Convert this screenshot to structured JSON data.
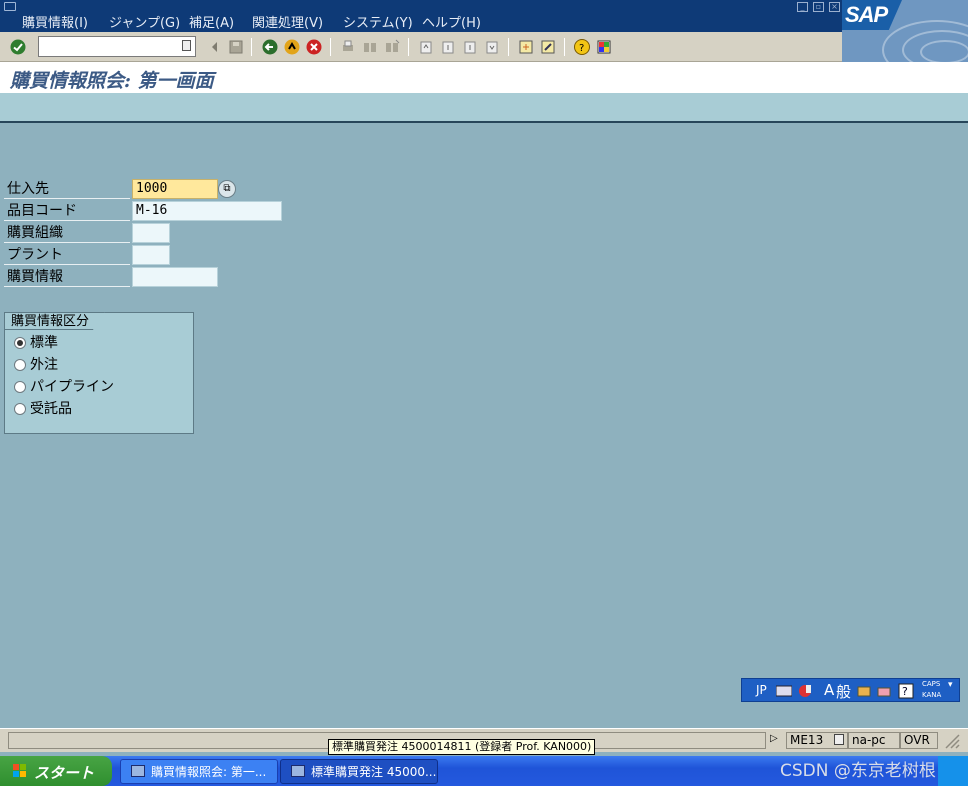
{
  "menu": {
    "items": [
      "購買情報(I)",
      "ジャンプ(G)",
      "補足(A)",
      "関連処理(V)",
      "システム(Y)",
      "ヘルプ(H)"
    ]
  },
  "brand": {
    "logo_text": "SAP",
    "accent": "#0e3a77"
  },
  "toolbar": {
    "command_value": "",
    "icons": [
      "enter-icon",
      "back-icon",
      "exit-icon",
      "cancel-icon",
      "print-icon",
      "find-icon",
      "find-next-icon",
      "first-page-icon",
      "previous-page-icon",
      "next-page-icon",
      "last-page-icon",
      "new-session-icon",
      "shortcut-icon",
      "help-icon",
      "layout-icon"
    ]
  },
  "title": "購買情報照会: 第一画面",
  "form": {
    "vendor": {
      "label": "仕入先",
      "value": "1000"
    },
    "material": {
      "label": "品目コード",
      "value": "M-16"
    },
    "purch_org": {
      "label": "購買組織",
      "value": ""
    },
    "plant": {
      "label": "プラント",
      "value": ""
    },
    "info_record": {
      "label": "購買情報",
      "value": ""
    }
  },
  "group": {
    "title": "購買情報区分",
    "options": [
      {
        "label": "標準",
        "selected": true
      },
      {
        "label": "外注",
        "selected": false
      },
      {
        "label": "パイプライン",
        "selected": false
      },
      {
        "label": "受託品",
        "selected": false
      }
    ]
  },
  "ime": {
    "lang": "JP",
    "mode": "A",
    "mode2": "般",
    "caps": "CAPS",
    "kana": "KANA"
  },
  "status": {
    "message": "",
    "tooltip": "標準購買発注 4500014811 (登録者 Prof. KAN000)",
    "transaction": "ME13",
    "server": "na-pc",
    "mode": "OVR"
  },
  "taskbar": {
    "start_label": "スタート",
    "tasks": [
      {
        "label": "購買情報照会: 第一..."
      },
      {
        "label": "標準購買発注 45000..."
      }
    ],
    "watermark": "CSDN @东京老树根"
  }
}
